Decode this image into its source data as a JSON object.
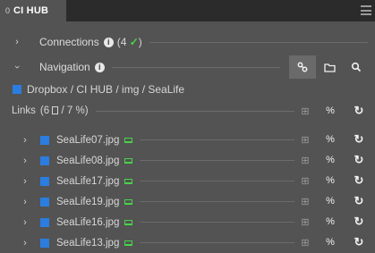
{
  "tab": {
    "index": "0",
    "title": "CI HUB"
  },
  "connections": {
    "label": "Connections",
    "count_prefix": "(4",
    "check": "✓",
    "count_suffix": ")"
  },
  "navigation": {
    "label": "Navigation"
  },
  "breadcrumb": "Dropbox / CI HUB / img / SeaLife",
  "links": {
    "label": "Links",
    "count_open": "(6",
    "count_mid": "/ 7",
    "count_close": ")"
  },
  "files": [
    {
      "name": "SeaLife07.jpg"
    },
    {
      "name": "SeaLife08.jpg"
    },
    {
      "name": "SeaLife17.jpg"
    },
    {
      "name": "SeaLife19.jpg"
    },
    {
      "name": "SeaLife16.jpg"
    },
    {
      "name": "SeaLife13.jpg"
    }
  ],
  "icons": {
    "menu": "menu-icon",
    "link": "link-icon",
    "folder": "folder-icon",
    "search": "search-icon",
    "refresh": "refresh-icon",
    "grid": "grid-icon",
    "monitor": "monitor-icon",
    "file": "file-icon"
  },
  "colors": {
    "accent_blue": "#2b7de0",
    "status_green": "#48d34a",
    "panel": "#535353",
    "titlebar": "#2b2b2b"
  }
}
